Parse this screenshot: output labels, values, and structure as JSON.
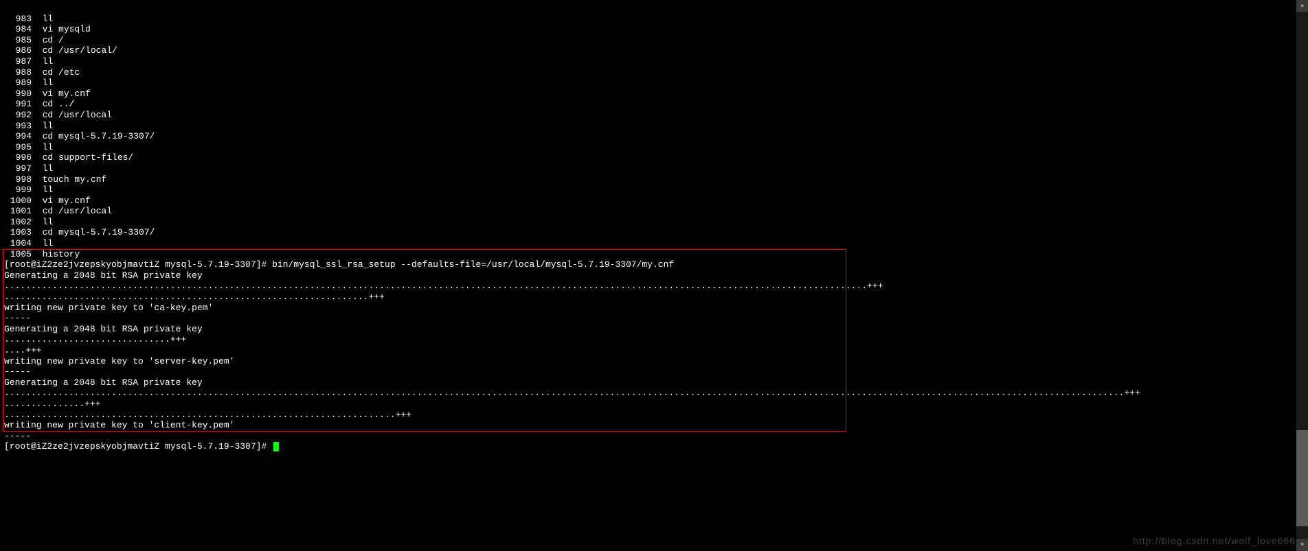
{
  "history": [
    {
      "num": 983,
      "cmd": "ll"
    },
    {
      "num": 984,
      "cmd": "vi mysqld"
    },
    {
      "num": 985,
      "cmd": "cd /"
    },
    {
      "num": 986,
      "cmd": "cd /usr/local/"
    },
    {
      "num": 987,
      "cmd": "ll"
    },
    {
      "num": 988,
      "cmd": "cd /etc"
    },
    {
      "num": 989,
      "cmd": "ll"
    },
    {
      "num": 990,
      "cmd": "vi my.cnf"
    },
    {
      "num": 991,
      "cmd": "cd ../"
    },
    {
      "num": 992,
      "cmd": "cd /usr/local"
    },
    {
      "num": 993,
      "cmd": "ll"
    },
    {
      "num": 994,
      "cmd": "cd mysql-5.7.19-3307/"
    },
    {
      "num": 995,
      "cmd": "ll"
    },
    {
      "num": 996,
      "cmd": "cd support-files/"
    },
    {
      "num": 997,
      "cmd": "ll"
    },
    {
      "num": 998,
      "cmd": "touch my.cnf"
    },
    {
      "num": 999,
      "cmd": "ll"
    },
    {
      "num": 1000,
      "cmd": "vi my.cnf"
    },
    {
      "num": 1001,
      "cmd": "cd /usr/local"
    },
    {
      "num": 1002,
      "cmd": "ll"
    },
    {
      "num": 1003,
      "cmd": "cd mysql-5.7.19-3307/"
    },
    {
      "num": 1004,
      "cmd": "ll"
    },
    {
      "num": 1005,
      "cmd": "history"
    }
  ],
  "cmd_prompt": "[root@iZ2ze2jvzepskyobjmavtiZ mysql-5.7.19-3307]# ",
  "ssl_command": "bin/mysql_ssl_rsa_setup --defaults-file=/usr/local/mysql-5.7.19-3307/my.cnf",
  "output": [
    "Generating a 2048 bit RSA private key",
    ".................................................................................................................................................................+++",
    "....................................................................+++",
    "writing new private key to 'ca-key.pem'",
    "-----",
    "Generating a 2048 bit RSA private key",
    "...............................+++",
    "....+++",
    "writing new private key to 'server-key.pem'",
    "-----",
    "Generating a 2048 bit RSA private key",
    ".................................................................................................................................................................................................................+++",
    "...............+++",
    ".........................................................................+++",
    "writing new private key to 'client-key.pem'",
    "-----"
  ],
  "watermark": "http://blog.csdn.net/wolf_love666",
  "scroll": {
    "up": "▲",
    "down": "▼"
  }
}
